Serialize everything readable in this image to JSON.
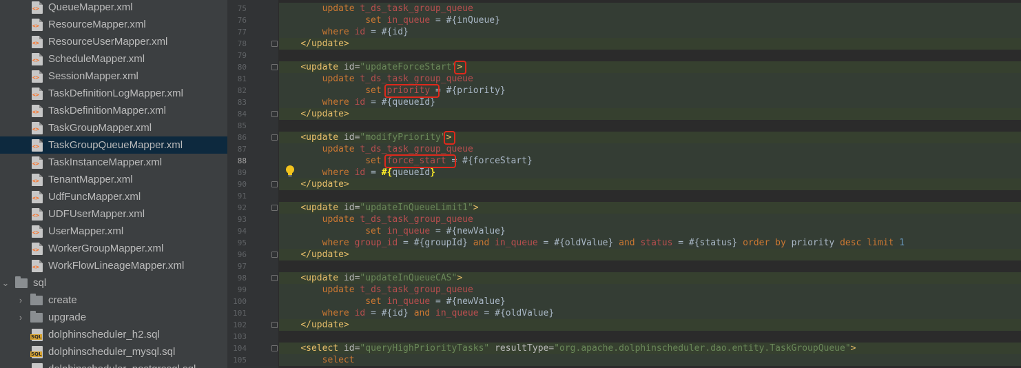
{
  "tree": {
    "items": [
      {
        "kind": "xml",
        "label": "QueueMapper.xml"
      },
      {
        "kind": "xml",
        "label": "ResourceMapper.xml"
      },
      {
        "kind": "xml",
        "label": "ResourceUserMapper.xml"
      },
      {
        "kind": "xml",
        "label": "ScheduleMapper.xml"
      },
      {
        "kind": "xml",
        "label": "SessionMapper.xml"
      },
      {
        "kind": "xml",
        "label": "TaskDefinitionLogMapper.xml"
      },
      {
        "kind": "xml",
        "label": "TaskDefinitionMapper.xml"
      },
      {
        "kind": "xml",
        "label": "TaskGroupMapper.xml"
      },
      {
        "kind": "xml",
        "label": "TaskGroupQueueMapper.xml",
        "selected": true
      },
      {
        "kind": "xml",
        "label": "TaskInstanceMapper.xml"
      },
      {
        "kind": "xml",
        "label": "TenantMapper.xml"
      },
      {
        "kind": "xml",
        "label": "UdfFuncMapper.xml"
      },
      {
        "kind": "xml",
        "label": "UDFUserMapper.xml"
      },
      {
        "kind": "xml",
        "label": "UserMapper.xml"
      },
      {
        "kind": "xml",
        "label": "WorkerGroupMapper.xml"
      },
      {
        "kind": "xml",
        "label": "WorkFlowLineageMapper.xml"
      },
      {
        "kind": "folder",
        "label": "sql",
        "expanded": true
      },
      {
        "kind": "subfolder",
        "label": "create"
      },
      {
        "kind": "subfolder",
        "label": "upgrade"
      },
      {
        "kind": "sql",
        "label": "dolphinscheduler_h2.sql"
      },
      {
        "kind": "sql",
        "label": "dolphinscheduler_mysql.sql"
      },
      {
        "kind": "sql",
        "label": "dolphinscheduler_postgresql.sql"
      }
    ],
    "icon_names": {
      "xml": "xml-file-icon",
      "sql": "sql-file-icon",
      "folder": "folder-icon",
      "chevron": "chevron-right-icon"
    }
  },
  "editor": {
    "current_line": 88,
    "lines": [
      {
        "n": 75,
        "tokens": [
          [
            "p",
            "        "
          ],
          [
            "kw",
            "update "
          ],
          [
            "tbl",
            "t_ds_task_group_queue"
          ]
        ]
      },
      {
        "n": 76,
        "tokens": [
          [
            "p",
            "                "
          ],
          [
            "kw",
            "set "
          ],
          [
            "col",
            "in_queue"
          ],
          [
            "p",
            " = #{inQueue}"
          ]
        ]
      },
      {
        "n": 77,
        "tokens": [
          [
            "p",
            "        "
          ],
          [
            "kw",
            "where "
          ],
          [
            "col",
            "id"
          ],
          [
            "p",
            " = #{id}"
          ]
        ]
      },
      {
        "n": 78,
        "tokens": [
          [
            "p",
            "    "
          ],
          [
            "tag",
            "</update>"
          ]
        ]
      },
      {
        "n": 79,
        "tokens": []
      },
      {
        "n": 80,
        "tokens": [
          [
            "p",
            "    "
          ],
          [
            "tag",
            "<update "
          ],
          [
            "attr",
            "id="
          ],
          [
            "str",
            "\"updateForceStart\""
          ],
          [
            "tag",
            ">"
          ]
        ]
      },
      {
        "n": 81,
        "tokens": [
          [
            "p",
            "        "
          ],
          [
            "kw",
            "update "
          ],
          [
            "tbl",
            "t_ds_task_group_queue"
          ]
        ]
      },
      {
        "n": 82,
        "tokens": [
          [
            "p",
            "                "
          ],
          [
            "kw",
            "set "
          ],
          [
            "col",
            "priority"
          ],
          [
            "p",
            " = #{priority}"
          ]
        ]
      },
      {
        "n": 83,
        "tokens": [
          [
            "p",
            "        "
          ],
          [
            "kw",
            "where "
          ],
          [
            "col",
            "id"
          ],
          [
            "p",
            " = #{queueId}"
          ]
        ]
      },
      {
        "n": 84,
        "tokens": [
          [
            "p",
            "    "
          ],
          [
            "tag",
            "</update>"
          ]
        ]
      },
      {
        "n": 85,
        "tokens": []
      },
      {
        "n": 86,
        "tokens": [
          [
            "p",
            "    "
          ],
          [
            "tag",
            "<update "
          ],
          [
            "attr",
            "id="
          ],
          [
            "str",
            "\"modifyPriority\""
          ],
          [
            "tag",
            ">"
          ]
        ]
      },
      {
        "n": 87,
        "tokens": [
          [
            "p",
            "        "
          ],
          [
            "kw",
            "update "
          ],
          [
            "tbl",
            "t_ds_task_group_queue"
          ]
        ]
      },
      {
        "n": 88,
        "tokens": [
          [
            "p",
            "                "
          ],
          [
            "kw",
            "set "
          ],
          [
            "col",
            "force_start"
          ],
          [
            "p",
            " = #{forceStart}"
          ]
        ]
      },
      {
        "n": 89,
        "tokens": [
          [
            "p",
            "        "
          ],
          [
            "kw",
            "where "
          ],
          [
            "col",
            "id"
          ],
          [
            "p",
            " = "
          ],
          [
            "hl",
            "#{"
          ],
          [
            "p",
            "queueId"
          ],
          [
            "hl",
            "}"
          ]
        ]
      },
      {
        "n": 90,
        "tokens": [
          [
            "p",
            "    "
          ],
          [
            "tag",
            "</update>"
          ]
        ]
      },
      {
        "n": 91,
        "tokens": []
      },
      {
        "n": 92,
        "tokens": [
          [
            "p",
            "    "
          ],
          [
            "tag",
            "<update "
          ],
          [
            "attr",
            "id="
          ],
          [
            "str",
            "\"updateInQueueLimit1\""
          ],
          [
            "tag",
            ">"
          ]
        ]
      },
      {
        "n": 93,
        "tokens": [
          [
            "p",
            "        "
          ],
          [
            "kw",
            "update "
          ],
          [
            "tbl",
            "t_ds_task_group_queue"
          ]
        ]
      },
      {
        "n": 94,
        "tokens": [
          [
            "p",
            "                "
          ],
          [
            "kw",
            "set "
          ],
          [
            "col",
            "in_queue"
          ],
          [
            "p",
            " = #{newValue}"
          ]
        ]
      },
      {
        "n": 95,
        "tokens": [
          [
            "p",
            "        "
          ],
          [
            "kw",
            "where "
          ],
          [
            "col",
            "group_id"
          ],
          [
            "p",
            " = #{groupId} "
          ],
          [
            "kw",
            "and "
          ],
          [
            "col",
            "in_queue"
          ],
          [
            "p",
            " = #{oldValue} "
          ],
          [
            "kw",
            "and "
          ],
          [
            "col",
            "status"
          ],
          [
            "p",
            " = #{status} "
          ],
          [
            "kw",
            "order"
          ],
          [
            "p",
            " "
          ],
          [
            "kw",
            "by "
          ],
          [
            "p",
            "priority "
          ],
          [
            "kw",
            "desc "
          ],
          [
            "kw",
            "limit "
          ],
          [
            "num",
            "1"
          ]
        ]
      },
      {
        "n": 96,
        "tokens": [
          [
            "p",
            "    "
          ],
          [
            "tag",
            "</update>"
          ]
        ]
      },
      {
        "n": 97,
        "tokens": []
      },
      {
        "n": 98,
        "tokens": [
          [
            "p",
            "    "
          ],
          [
            "tag",
            "<update "
          ],
          [
            "attr",
            "id="
          ],
          [
            "str",
            "\"updateInQueueCAS\""
          ],
          [
            "tag",
            ">"
          ]
        ]
      },
      {
        "n": 99,
        "tokens": [
          [
            "p",
            "        "
          ],
          [
            "kw",
            "update "
          ],
          [
            "tbl",
            "t_ds_task_group_queue"
          ]
        ]
      },
      {
        "n": 100,
        "tokens": [
          [
            "p",
            "                "
          ],
          [
            "kw",
            "set "
          ],
          [
            "col",
            "in_queue"
          ],
          [
            "p",
            " = #{newValue}"
          ]
        ]
      },
      {
        "n": 101,
        "tokens": [
          [
            "p",
            "        "
          ],
          [
            "kw",
            "where "
          ],
          [
            "col",
            "id"
          ],
          [
            "p",
            " = #{id} "
          ],
          [
            "kw",
            "and "
          ],
          [
            "col",
            "in_queue"
          ],
          [
            "p",
            " = #{oldValue}"
          ]
        ]
      },
      {
        "n": 102,
        "tokens": [
          [
            "p",
            "    "
          ],
          [
            "tag",
            "</update>"
          ]
        ]
      },
      {
        "n": 103,
        "tokens": []
      },
      {
        "n": 104,
        "tokens": [
          [
            "p",
            "    "
          ],
          [
            "tag",
            "<select "
          ],
          [
            "attr",
            "id="
          ],
          [
            "str",
            "\"queryHighPriorityTasks\""
          ],
          [
            "p",
            " "
          ],
          [
            "attr",
            "resultType="
          ],
          [
            "str",
            "\"org.apache.dolphinscheduler.dao.entity.TaskGroupQueue\""
          ],
          [
            "tag",
            ">"
          ]
        ]
      },
      {
        "n": 105,
        "tokens": [
          [
            "p",
            "        "
          ],
          [
            "kw",
            "select"
          ]
        ]
      }
    ],
    "highlight_color": "#e0281b",
    "intention_icon": "lightbulb-icon"
  }
}
